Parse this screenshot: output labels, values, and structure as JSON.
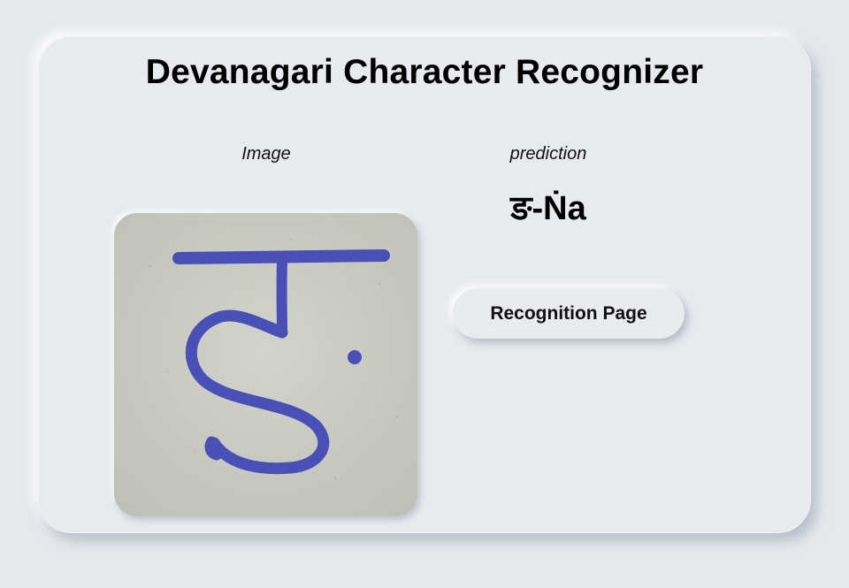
{
  "page": {
    "title": "Devanagari Character Recognizer"
  },
  "image_panel": {
    "label": "Image",
    "image_subject": "handwritten Devanagari character in blue ink on paper"
  },
  "prediction_panel": {
    "label": "prediction",
    "result": "ङ-Ṅa"
  },
  "actions": {
    "recognition_button_label": "Recognition Page"
  },
  "colors": {
    "background": "#e6e8eb",
    "card": "#e8eaed",
    "ink": "#4a4fb0",
    "paper": "#c9cbc3"
  }
}
